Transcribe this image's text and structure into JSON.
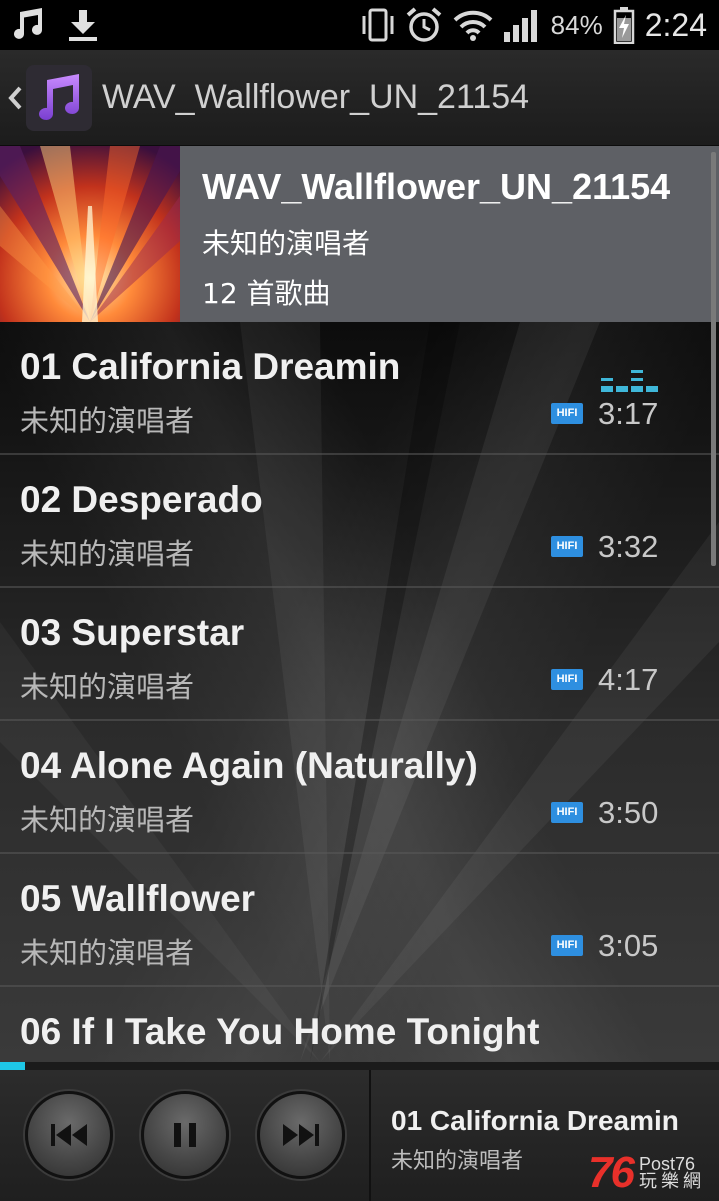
{
  "status_bar": {
    "icons": [
      "music-note-icon",
      "download-icon",
      "vibrate-icon",
      "alarm-icon",
      "wifi-icon",
      "signal-icon",
      "battery-charging-icon"
    ],
    "battery": "84%",
    "time": "2:24"
  },
  "action_bar": {
    "title": "WAV_Wallflower_UN_21154"
  },
  "album": {
    "title": "WAV_Wallflower_UN_21154",
    "artist": "未知的演唱者",
    "song_count": "12 首歌曲"
  },
  "songs": [
    {
      "title": "01 California Dreamin",
      "artist": "未知的演唱者",
      "badge": "HIFI",
      "duration": "3:17",
      "playing": true
    },
    {
      "title": "02 Desperado",
      "artist": "未知的演唱者",
      "badge": "HIFI",
      "duration": "3:32"
    },
    {
      "title": "03 Superstar",
      "artist": "未知的演唱者",
      "badge": "HIFI",
      "duration": "4:17"
    },
    {
      "title": "04 Alone Again (Naturally)",
      "artist": "未知的演唱者",
      "badge": "HIFI",
      "duration": "3:50"
    },
    {
      "title": "05 Wallflower",
      "artist": "未知的演唱者",
      "badge": "HIFI",
      "duration": "3:05"
    },
    {
      "title": "06 If I Take You Home Tonight"
    }
  ],
  "playback": {
    "progress": 0.035,
    "now_playing_title": "01 California Dreamin",
    "now_playing_artist": "未知的演唱者"
  },
  "watermark": {
    "number": "76",
    "brand": "Post76",
    "sub": "玩樂網"
  },
  "colors": {
    "accent": "#1ec7e6",
    "hifi_badge": "#2e8fe0",
    "album_header_bg": "#5e6065"
  }
}
